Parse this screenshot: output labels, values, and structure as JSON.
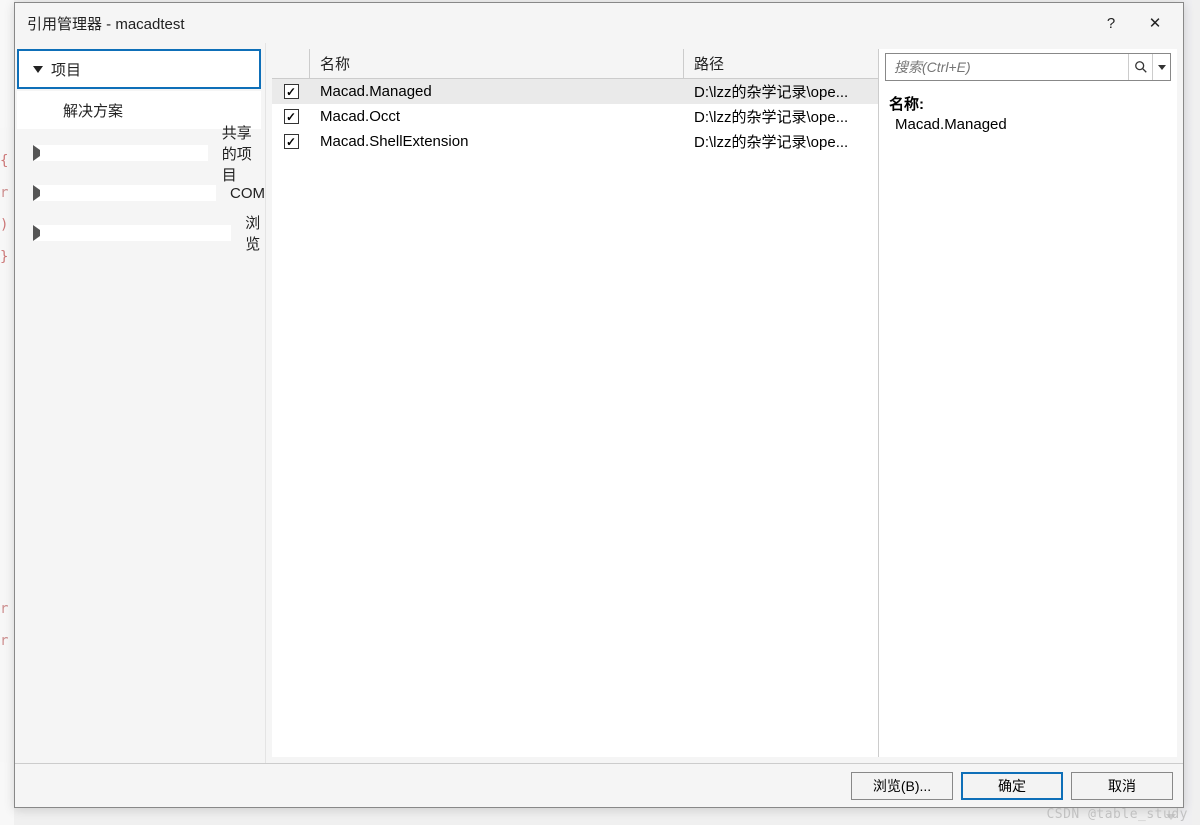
{
  "window": {
    "title": "引用管理器 - macadtest",
    "help_tooltip": "?",
    "close_tooltip": "✕"
  },
  "sidebar": {
    "items": [
      {
        "label": "项目",
        "expanded": true,
        "selected": true
      },
      {
        "label": "共享的项目",
        "expanded": false
      },
      {
        "label": "COM",
        "expanded": false
      },
      {
        "label": "浏览",
        "expanded": false
      }
    ],
    "subitems": [
      {
        "label": "解决方案"
      }
    ]
  },
  "table": {
    "columns": {
      "name": "名称",
      "path": "路径"
    },
    "rows": [
      {
        "checked": true,
        "selected": true,
        "name": "Macad.Managed",
        "path": "D:\\lzz的杂学记录\\ope..."
      },
      {
        "checked": true,
        "selected": false,
        "name": "Macad.Occt",
        "path": "D:\\lzz的杂学记录\\ope..."
      },
      {
        "checked": true,
        "selected": false,
        "name": "Macad.ShellExtension",
        "path": "D:\\lzz的杂学记录\\ope..."
      }
    ]
  },
  "search": {
    "placeholder": "搜索(Ctrl+E)"
  },
  "details": {
    "label": "名称:",
    "value": "Macad.Managed"
  },
  "footer": {
    "browse": "浏览(B)...",
    "ok": "确定",
    "cancel": "取消"
  },
  "watermark": "CSDN @table_study"
}
